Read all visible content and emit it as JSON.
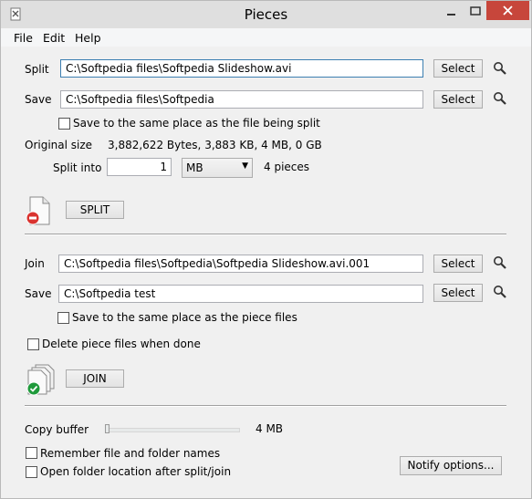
{
  "window": {
    "title": "Pieces"
  },
  "menu": {
    "file": "File",
    "edit": "Edit",
    "help": "Help"
  },
  "split": {
    "label": "Split",
    "path": "C:\\Softpedia files\\Softpedia Slideshow.avi",
    "select_label": "Select",
    "save_label": "Save",
    "save_path": "C:\\Softpedia files\\Softpedia",
    "save_select_label": "Select",
    "same_place_label": "Save to the same place as the file being split",
    "same_place_checked": false,
    "original_size_label": "Original size",
    "original_size_value": "3,882,622 Bytes, 3,883 KB, 4 MB, 0 GB",
    "split_into_label": "Split into",
    "split_into_value": "1",
    "unit_value": "MB",
    "pieces_text": "4 pieces",
    "button_label": "SPLIT"
  },
  "join": {
    "label": "Join",
    "path": "C:\\Softpedia files\\Softpedia\\Softpedia Slideshow.avi.001",
    "select_label": "Select",
    "save_label": "Save",
    "save_path": "C:\\Softpedia test",
    "save_select_label": "Select",
    "same_place_label": "Save to the same place as the piece files",
    "same_place_checked": false,
    "delete_label": "Delete piece files when done",
    "delete_checked": false,
    "button_label": "JOIN"
  },
  "options": {
    "copy_buffer_label": "Copy buffer",
    "copy_buffer_value": "4 MB",
    "copy_buffer_level": 0.0,
    "remember_label": "Remember file and folder names",
    "remember_checked": false,
    "open_folder_label": "Open folder location after split/join",
    "open_folder_checked": false,
    "notify_label": "Notify options..."
  },
  "colors": {
    "close_button": "#c7463b",
    "focus_border": "#3c7fb1"
  },
  "icons": [
    "app-icon",
    "minimize-icon",
    "maximize-icon",
    "close-icon",
    "search-icon",
    "split-file-icon",
    "join-files-icon",
    "chevron-down-icon"
  ]
}
